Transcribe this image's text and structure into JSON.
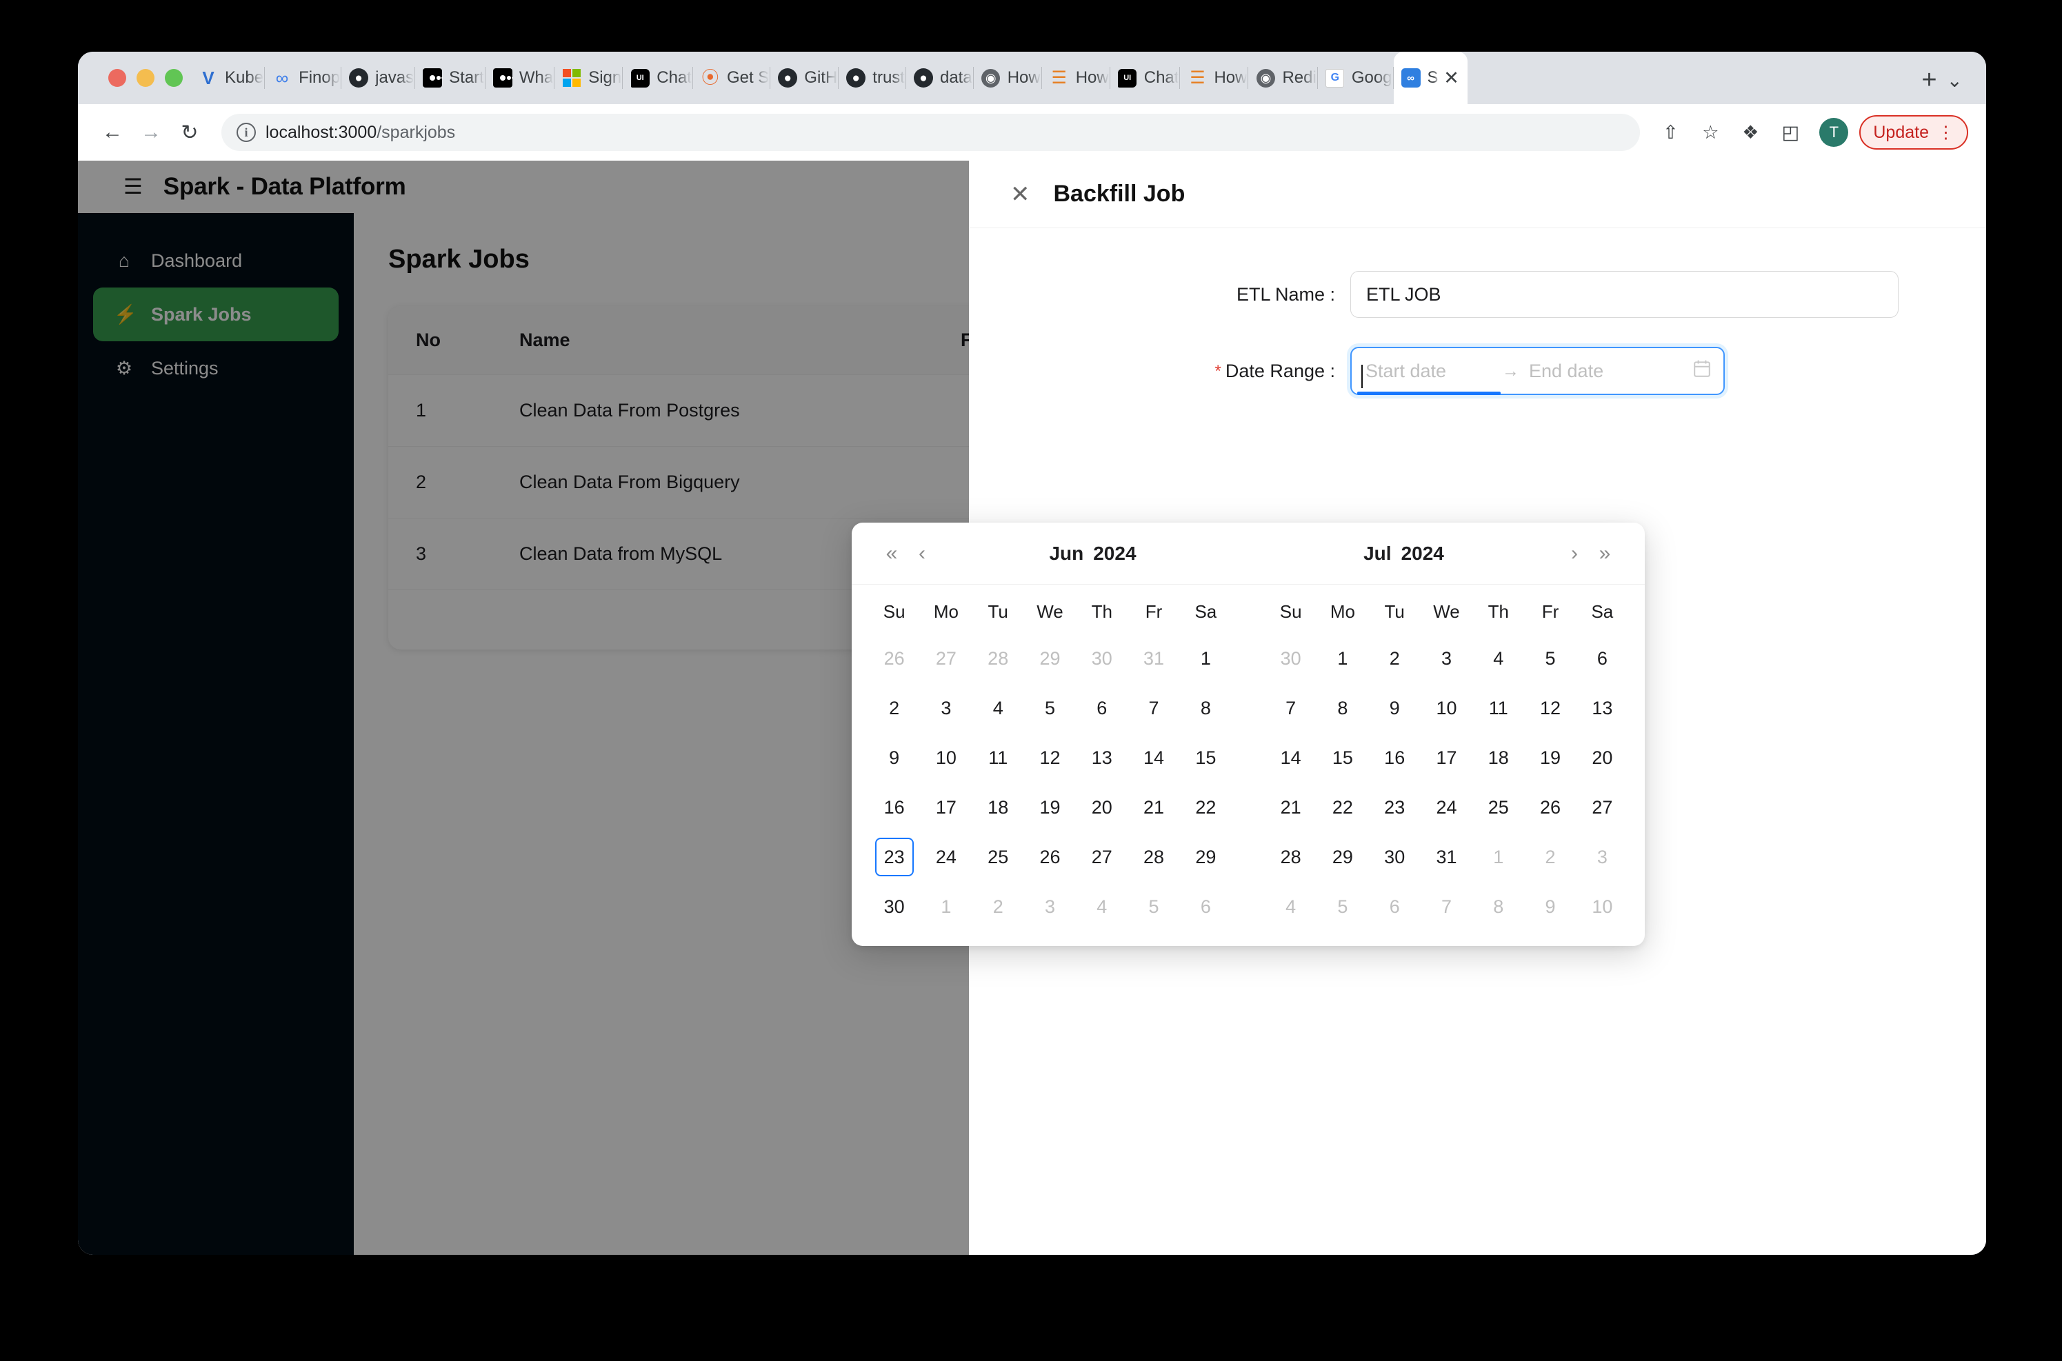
{
  "browser": {
    "tabs": [
      {
        "title": "Kube",
        "icon": "vercel-icon",
        "active": false
      },
      {
        "title": "Finop",
        "icon": "infinity-icon",
        "active": false
      },
      {
        "title": "javas",
        "icon": "github-icon",
        "active": false
      },
      {
        "title": "Start",
        "icon": "medium-icon",
        "active": false
      },
      {
        "title": "Wha",
        "icon": "medium-icon",
        "active": false
      },
      {
        "title": "Sign",
        "icon": "microsoft-icon",
        "active": false
      },
      {
        "title": "Chat",
        "icon": "chat-icon",
        "active": false
      },
      {
        "title": "Get S",
        "icon": "spinner-icon",
        "active": false
      },
      {
        "title": "GitH",
        "icon": "github-icon",
        "active": false
      },
      {
        "title": "trust",
        "icon": "github-icon",
        "active": false
      },
      {
        "title": "data",
        "icon": "github-icon",
        "active": false
      },
      {
        "title": "How",
        "icon": "globe-icon",
        "active": false
      },
      {
        "title": "How",
        "icon": "stackoverflow-icon",
        "active": false
      },
      {
        "title": "Chat",
        "icon": "chat-icon",
        "active": false
      },
      {
        "title": "How",
        "icon": "stackoverflow-icon",
        "active": false
      },
      {
        "title": "Redi",
        "icon": "globe-icon",
        "active": false
      },
      {
        "title": "Goog",
        "icon": "google-translate-icon",
        "active": false
      },
      {
        "title": "S",
        "icon": "airflow-icon",
        "active": true
      }
    ],
    "new_tab_label": "+",
    "tab_list_label": "⌄",
    "back_label": "←",
    "forward_label": "→",
    "reload_label": "↻",
    "url_host": "localhost:3000",
    "url_path": "/sparkjobs",
    "share_icon": "⇧",
    "bookmark_icon": "☆",
    "extensions_icon": "❖",
    "sidepanel_icon": "◰",
    "avatar_initial": "T",
    "update_label": "Update",
    "update_menu": "⋮"
  },
  "app": {
    "title": "Spark - Data Platform",
    "collapse_icon": "☰",
    "sidebar": {
      "items": [
        {
          "label": "Dashboard",
          "icon": "⌂",
          "active": false
        },
        {
          "label": "Spark Jobs",
          "icon": "⚡",
          "active": true
        },
        {
          "label": "Settings",
          "icon": "⚙",
          "active": false
        }
      ]
    },
    "content": {
      "page_title": "Spark Jobs",
      "table": {
        "columns": [
          "No",
          "Name",
          "FREQUENCY"
        ],
        "rows": [
          {
            "no": "1",
            "name": "Clean Data From Postgres"
          },
          {
            "no": "2",
            "name": "Clean Data From Bigquery"
          },
          {
            "no": "3",
            "name": "Clean Data from MySQL"
          }
        ]
      }
    }
  },
  "drawer": {
    "close_icon": "✕",
    "title": "Backfill Job",
    "fields": {
      "etl_name": {
        "label": "ETL Name :",
        "value": "ETL JOB",
        "required": false
      },
      "date_range": {
        "label": "Date Range :",
        "required": true,
        "required_marker": "*",
        "start_placeholder": "Start date",
        "end_placeholder": "End date",
        "separator": "→",
        "calendar_icon": "Ὄ5",
        "start_value": "",
        "end_value": "",
        "focused_half": "start"
      }
    }
  },
  "calendar": {
    "nav": {
      "super_prev": "«",
      "prev": "‹",
      "next": "›",
      "super_next": "»"
    },
    "weekdays": [
      "Su",
      "Mo",
      "Tu",
      "We",
      "Th",
      "Fr",
      "Sa"
    ],
    "panels": [
      {
        "month": "Jun",
        "year": "2024",
        "weeks": [
          [
            {
              "d": "26",
              "out": true
            },
            {
              "d": "27",
              "out": true
            },
            {
              "d": "28",
              "out": true
            },
            {
              "d": "29",
              "out": true
            },
            {
              "d": "30",
              "out": true
            },
            {
              "d": "31",
              "out": true
            },
            {
              "d": "1",
              "out": false
            }
          ],
          [
            {
              "d": "2",
              "out": false
            },
            {
              "d": "3",
              "out": false
            },
            {
              "d": "4",
              "out": false
            },
            {
              "d": "5",
              "out": false
            },
            {
              "d": "6",
              "out": false
            },
            {
              "d": "7",
              "out": false
            },
            {
              "d": "8",
              "out": false
            }
          ],
          [
            {
              "d": "9",
              "out": false
            },
            {
              "d": "10",
              "out": false
            },
            {
              "d": "11",
              "out": false
            },
            {
              "d": "12",
              "out": false
            },
            {
              "d": "13",
              "out": false
            },
            {
              "d": "14",
              "out": false
            },
            {
              "d": "15",
              "out": false
            }
          ],
          [
            {
              "d": "16",
              "out": false
            },
            {
              "d": "17",
              "out": false
            },
            {
              "d": "18",
              "out": false
            },
            {
              "d": "19",
              "out": false
            },
            {
              "d": "20",
              "out": false
            },
            {
              "d": "21",
              "out": false
            },
            {
              "d": "22",
              "out": false
            }
          ],
          [
            {
              "d": "23",
              "out": false,
              "today": true
            },
            {
              "d": "24",
              "out": false
            },
            {
              "d": "25",
              "out": false
            },
            {
              "d": "26",
              "out": false
            },
            {
              "d": "27",
              "out": false
            },
            {
              "d": "28",
              "out": false
            },
            {
              "d": "29",
              "out": false
            }
          ],
          [
            {
              "d": "30",
              "out": false
            },
            {
              "d": "1",
              "out": true
            },
            {
              "d": "2",
              "out": true
            },
            {
              "d": "3",
              "out": true
            },
            {
              "d": "4",
              "out": true
            },
            {
              "d": "5",
              "out": true
            },
            {
              "d": "6",
              "out": true
            }
          ]
        ]
      },
      {
        "month": "Jul",
        "year": "2024",
        "weeks": [
          [
            {
              "d": "30",
              "out": true
            },
            {
              "d": "1",
              "out": false
            },
            {
              "d": "2",
              "out": false
            },
            {
              "d": "3",
              "out": false
            },
            {
              "d": "4",
              "out": false
            },
            {
              "d": "5",
              "out": false
            },
            {
              "d": "6",
              "out": false
            }
          ],
          [
            {
              "d": "7",
              "out": false
            },
            {
              "d": "8",
              "out": false
            },
            {
              "d": "9",
              "out": false
            },
            {
              "d": "10",
              "out": false
            },
            {
              "d": "11",
              "out": false
            },
            {
              "d": "12",
              "out": false
            },
            {
              "d": "13",
              "out": false
            }
          ],
          [
            {
              "d": "14",
              "out": false
            },
            {
              "d": "15",
              "out": false
            },
            {
              "d": "16",
              "out": false
            },
            {
              "d": "17",
              "out": false
            },
            {
              "d": "18",
              "out": false
            },
            {
              "d": "19",
              "out": false
            },
            {
              "d": "20",
              "out": false
            }
          ],
          [
            {
              "d": "21",
              "out": false
            },
            {
              "d": "22",
              "out": false
            },
            {
              "d": "23",
              "out": false
            },
            {
              "d": "24",
              "out": false
            },
            {
              "d": "25",
              "out": false
            },
            {
              "d": "26",
              "out": false
            },
            {
              "d": "27",
              "out": false
            }
          ],
          [
            {
              "d": "28",
              "out": false
            },
            {
              "d": "29",
              "out": false
            },
            {
              "d": "30",
              "out": false
            },
            {
              "d": "31",
              "out": false
            },
            {
              "d": "1",
              "out": true
            },
            {
              "d": "2",
              "out": true
            },
            {
              "d": "3",
              "out": true
            }
          ],
          [
            {
              "d": "4",
              "out": true
            },
            {
              "d": "5",
              "out": true
            },
            {
              "d": "6",
              "out": true
            },
            {
              "d": "7",
              "out": true
            },
            {
              "d": "8",
              "out": true
            },
            {
              "d": "9",
              "out": true
            },
            {
              "d": "10",
              "out": true
            }
          ]
        ]
      }
    ]
  },
  "colors": {
    "accent_green": "#389e4f",
    "sidebar_bg": "#020d17",
    "focus_blue": "#1677ff",
    "update_red": "#c5221f"
  }
}
